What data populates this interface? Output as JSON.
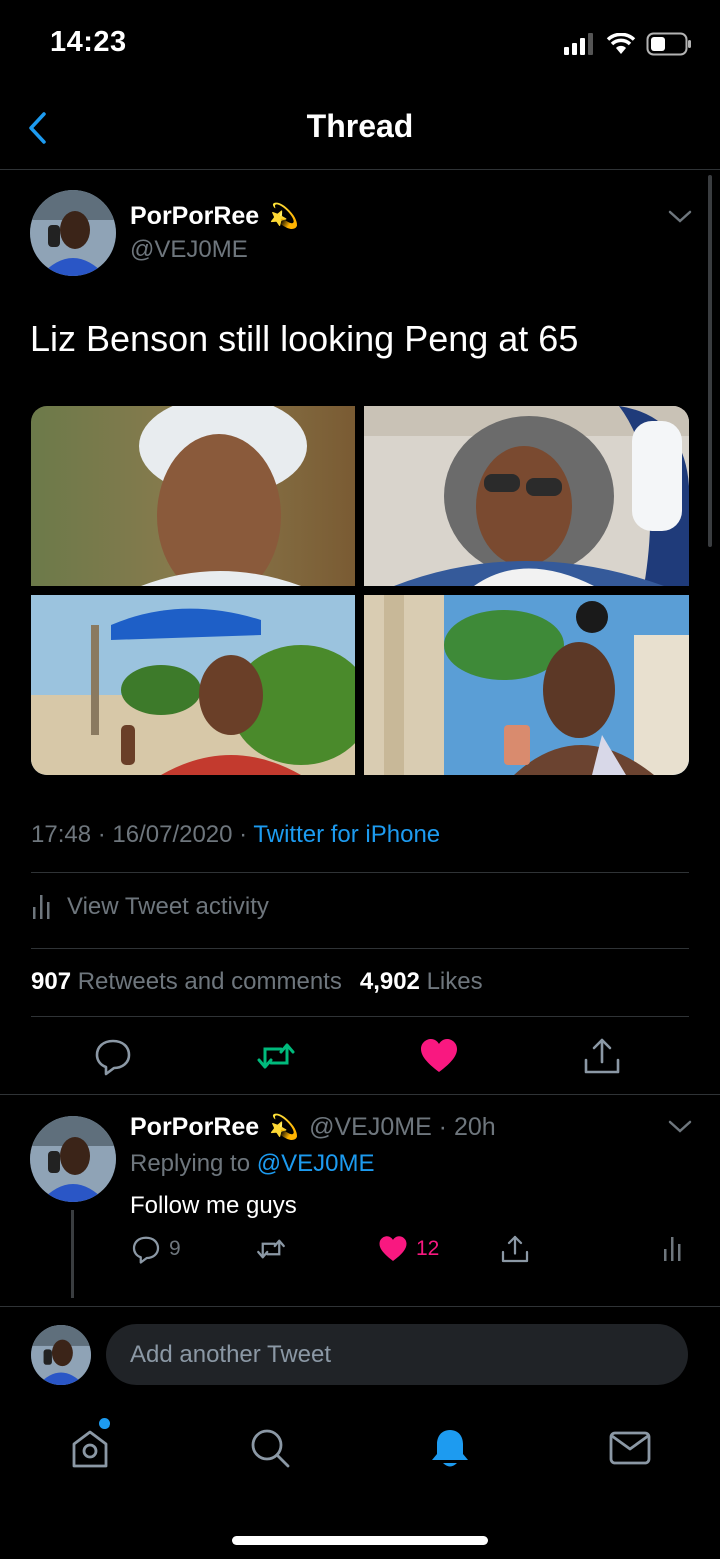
{
  "status_bar": {
    "time": "14:23"
  },
  "nav": {
    "title": "Thread"
  },
  "tweet": {
    "author_name": "PorPorRee",
    "author_emoji": "💫",
    "handle": "@VEJ0ME",
    "text": "Liz Benson still looking Peng at 65",
    "timestamp": "17:48 · 16/07/2020 · ",
    "source": "Twitter for iPhone",
    "activity_label": "View Tweet activity",
    "retweets_count": "907",
    "retweets_label": "Retweets and comments",
    "likes_count": "4,902",
    "likes_label": "Likes"
  },
  "reply": {
    "author_name": "PorPorRee",
    "author_emoji": "💫",
    "meta": "@VEJ0ME · 20h",
    "replying_prefix": "Replying to ",
    "replying_handle": "@VEJ0ME",
    "text": "Follow me guys",
    "reply_count": "9",
    "like_count": "12"
  },
  "composer": {
    "placeholder": "Add another Tweet"
  },
  "colors": {
    "accent": "#1d9bf0",
    "like": "#f91880",
    "retweet": "#00ba7c",
    "muted": "#6e767d"
  },
  "icons": [
    "back-chevron-icon",
    "chevron-down-icon",
    "reply-icon",
    "retweet-icon",
    "like-icon",
    "share-icon",
    "activity-icon",
    "home-icon",
    "search-icon",
    "notifications-icon",
    "messages-icon"
  ]
}
